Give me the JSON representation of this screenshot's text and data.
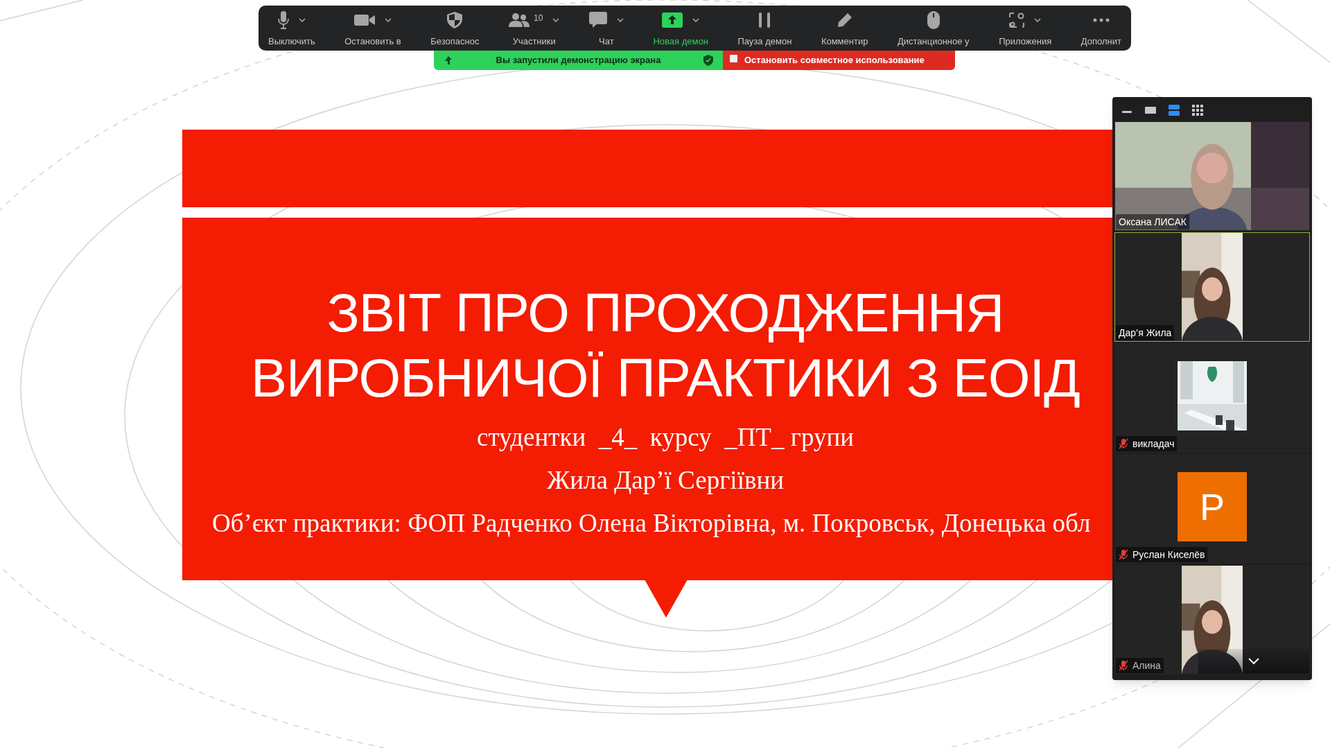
{
  "toolbar": {
    "buttons": [
      {
        "kind": "mic",
        "label": "Выключить",
        "dropdown": true,
        "active": false
      },
      {
        "kind": "video",
        "label": "Остановить в",
        "dropdown": true,
        "active": false
      },
      {
        "kind": "shield",
        "label": "Безопаснос",
        "dropdown": false,
        "active": false
      },
      {
        "kind": "participants",
        "label": "Участники",
        "badge": "10",
        "dropdown": true,
        "active": false
      },
      {
        "kind": "chat",
        "label": "Чат",
        "dropdown": true,
        "active": false
      },
      {
        "kind": "share",
        "label": "Новая демон",
        "dropdown": true,
        "active": true
      },
      {
        "kind": "pause",
        "label": "Пауза демон",
        "dropdown": false,
        "active": false
      },
      {
        "kind": "annotate",
        "label": "Комментир",
        "dropdown": false,
        "active": false
      },
      {
        "kind": "remote",
        "label": "Дистанционное у",
        "dropdown": false,
        "active": false
      },
      {
        "kind": "apps",
        "label": "Приложения",
        "dropdown": true,
        "active": false
      },
      {
        "kind": "more",
        "label": "Дополнит",
        "dropdown": false,
        "active": false
      }
    ]
  },
  "share_banner": {
    "message": "Вы запустили демонстрацию экрана",
    "stop_label": "Остановить совместное использование"
  },
  "slide": {
    "title_lines": [
      "ЗВІТ ПРО ПРОХОДЖЕННЯ",
      "ВИРОБНИЧОЇ ПРАКТИКИ З ЕОІД"
    ],
    "lines": [
      "студентки  _4_  курсу  _ПТ_ групи",
      "Жила Дар’ї Сергіївни",
      "Об’єкт практики: ФОП Радченко Олена Вікторівна, м. Покровськ, Донецька обл"
    ]
  },
  "video_panel": {
    "view_buttons": [
      {
        "kind": "minimize",
        "selected": false
      },
      {
        "kind": "speaker",
        "selected": false
      },
      {
        "kind": "strip",
        "selected": true
      },
      {
        "kind": "grid",
        "selected": false
      }
    ],
    "tiles": [
      {
        "kind": "video",
        "name": "Оксана ЛИСАК",
        "muted": false,
        "speaking": false
      },
      {
        "kind": "portrait",
        "name": "Дар’я Жила",
        "muted": false,
        "speaking": true
      },
      {
        "kind": "picture",
        "name": "викладач",
        "muted": true,
        "speaking": false
      },
      {
        "kind": "avatar",
        "initial": "Р",
        "name": "Руслан Киселёв",
        "muted": true,
        "speaking": false
      },
      {
        "kind": "portrait",
        "name": "Алина",
        "muted": true,
        "speaking": false
      }
    ]
  }
}
